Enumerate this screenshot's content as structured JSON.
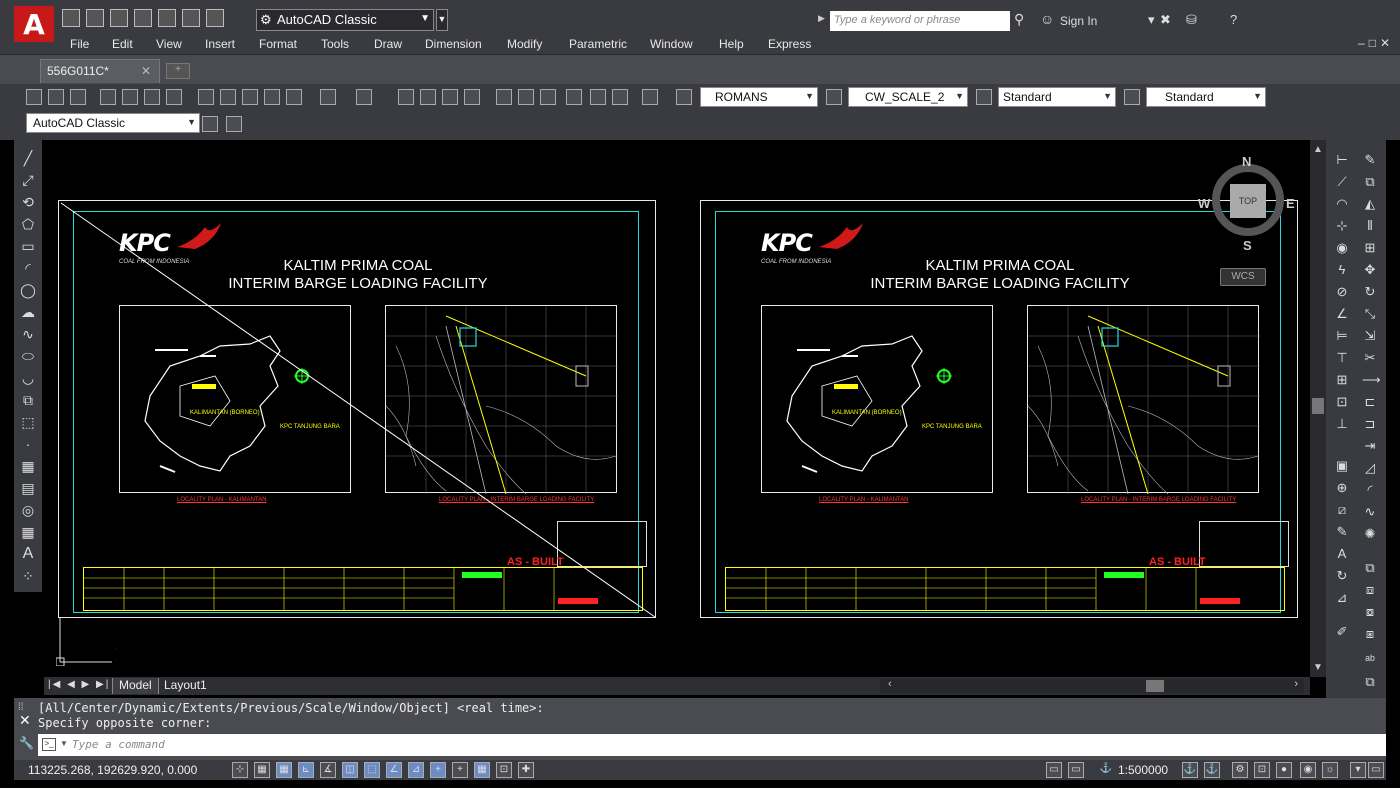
{
  "app": {
    "workspace": "AutoCAD Classic",
    "search_placeholder": "Type a keyword or phrase",
    "sign_in": "Sign In",
    "logo_letter": "A"
  },
  "menu": [
    "File",
    "Edit",
    "View",
    "Insert",
    "Format",
    "Tools",
    "Draw",
    "Dimension",
    "Modify",
    "Parametric",
    "Window",
    "Help",
    "Express"
  ],
  "file_tab": {
    "label": "556G011C*",
    "close": "✕"
  },
  "styles": {
    "text_style": "ROMANS",
    "dim_style": "CW_SCALE_2",
    "table_style": "Standard",
    "multileader_style": "Standard"
  },
  "workspace_row2": "AutoCAD Classic",
  "drawing": {
    "logo_text": "KPC",
    "logo_tagline": "COAL FROM INDONESIA",
    "title_line1": "KALTIM PRIMA COAL",
    "title_line2": "INTERIM BARGE LOADING FACILITY",
    "caption_left": "LOCALITY PLAN - KALIMANTAN",
    "caption_right": "LOCALITY PLAN - INTERIM BARGE LOADING FACILITY",
    "kalimantan_label": "KALIMANTAN (BORNEO)",
    "tbi_label": "KPC TANJUNG BARA",
    "as_built": "AS - BUILT"
  },
  "navcube": {
    "n": "N",
    "s": "S",
    "e": "E",
    "w": "W",
    "top": "TOP",
    "wcs": "WCS"
  },
  "layout_tabs": {
    "model": "Model",
    "layout1": "Layout1"
  },
  "command": {
    "history_line1": "[All/Center/Dynamic/Extents/Previous/Scale/Window/Object] <real time>:",
    "history_line2": "Specify opposite corner:",
    "placeholder": "Type a command"
  },
  "status": {
    "coordinates": "113225.268, 192629.920, 0.000",
    "annotation_scale": "1:500000"
  },
  "colors": {
    "accent_red": "#c8191a",
    "cyan_border": "#22dddd",
    "yellow": "#ffff00",
    "drawing_red": "#ff3333"
  }
}
